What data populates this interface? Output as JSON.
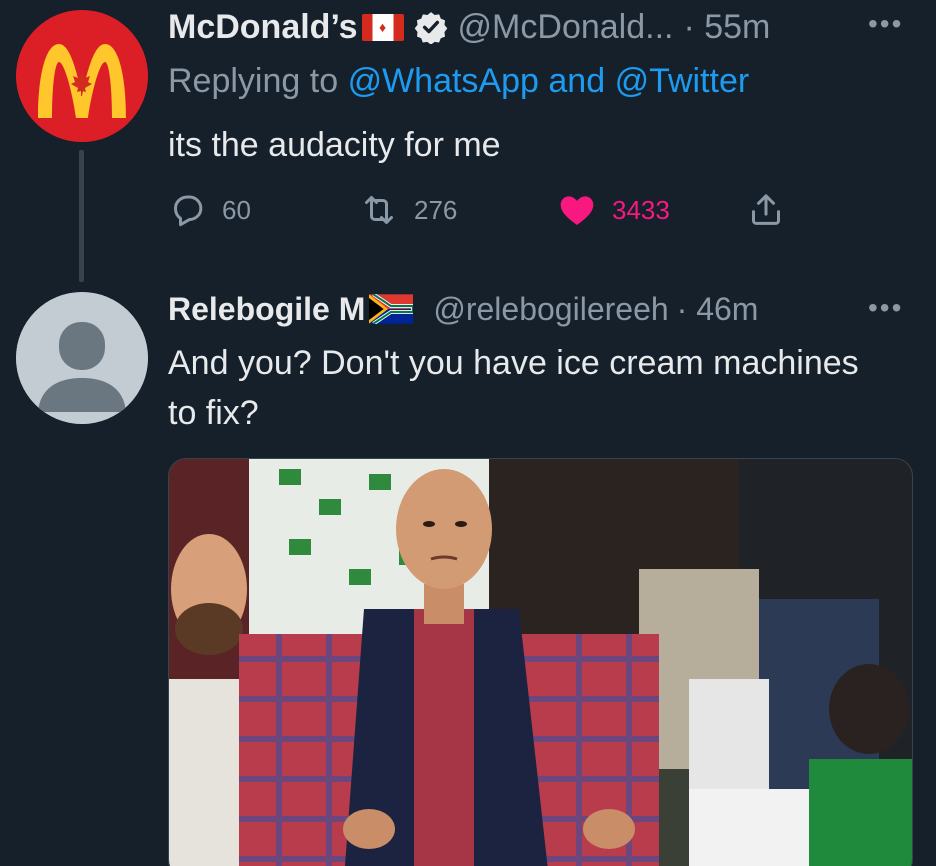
{
  "tweet1": {
    "name": "McDonald’s",
    "handle": "@McDonald...",
    "time": "· 55m",
    "replying_prefix": "Replying to",
    "reply_to_1": "@WhatsApp",
    "reply_and": "and",
    "reply_to_2": "@Twitter",
    "text": "its the audacity for me",
    "reply_count": "60",
    "retweet_count": "276",
    "like_count": "3433",
    "liked": true,
    "flag": "canada-flag-icon",
    "verified": true
  },
  "tweet2": {
    "name": "Relebogile M",
    "handle": "@relebogilereeh",
    "time": "· 46m",
    "text": "And you? Don't you have ice cream machines to fix?",
    "flag": "south-africa-flag-icon",
    "media": "photo of a frustrated bald man in a navy vest with hands on hips in a crowd of cricket fans"
  },
  "colors": {
    "background": "#15202b",
    "link": "#1d9bf0",
    "like": "#f91880",
    "muted": "#8b98a5",
    "mcdonalds_red": "#dc1f26",
    "mcdonalds_yellow": "#ffc72c"
  },
  "icons": {
    "reply": "reply-icon",
    "retweet": "retweet-icon",
    "like": "heart-icon",
    "share": "share-icon",
    "more": "more-icon",
    "verified": "verified-badge-icon"
  }
}
